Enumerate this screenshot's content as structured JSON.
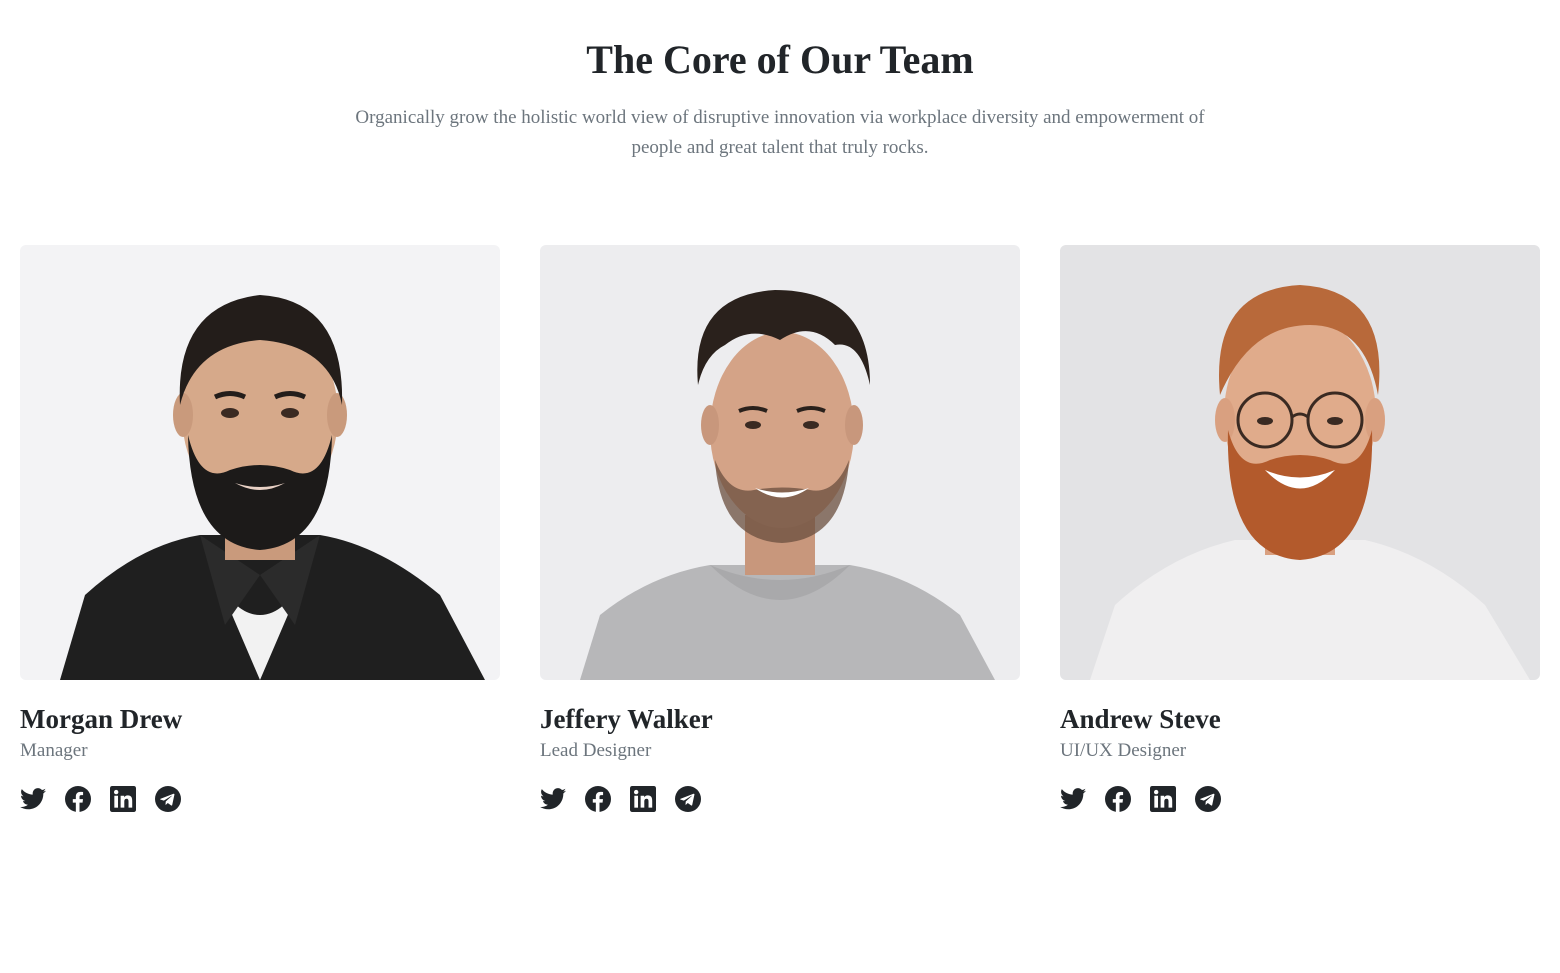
{
  "section": {
    "title": "The Core of Our Team",
    "subtitle": "Organically grow the holistic world view of disruptive innovation via workplace diversity and empowerment of people and great talent that truly rocks."
  },
  "team": [
    {
      "name": "Morgan Drew",
      "role": "Manager",
      "socials": [
        "twitter-icon",
        "facebook-icon",
        "linkedin-icon",
        "telegram-icon"
      ]
    },
    {
      "name": "Jeffery Walker",
      "role": "Lead Designer",
      "socials": [
        "twitter-icon",
        "facebook-icon",
        "linkedin-icon",
        "telegram-icon"
      ]
    },
    {
      "name": "Andrew Steve",
      "role": "UI/UX Designer",
      "socials": [
        "twitter-icon",
        "facebook-icon",
        "linkedin-icon",
        "telegram-icon"
      ]
    }
  ],
  "colors": {
    "heading": "#212529",
    "muted": "#6c757d",
    "icon": "#212529",
    "background": "#ffffff"
  }
}
